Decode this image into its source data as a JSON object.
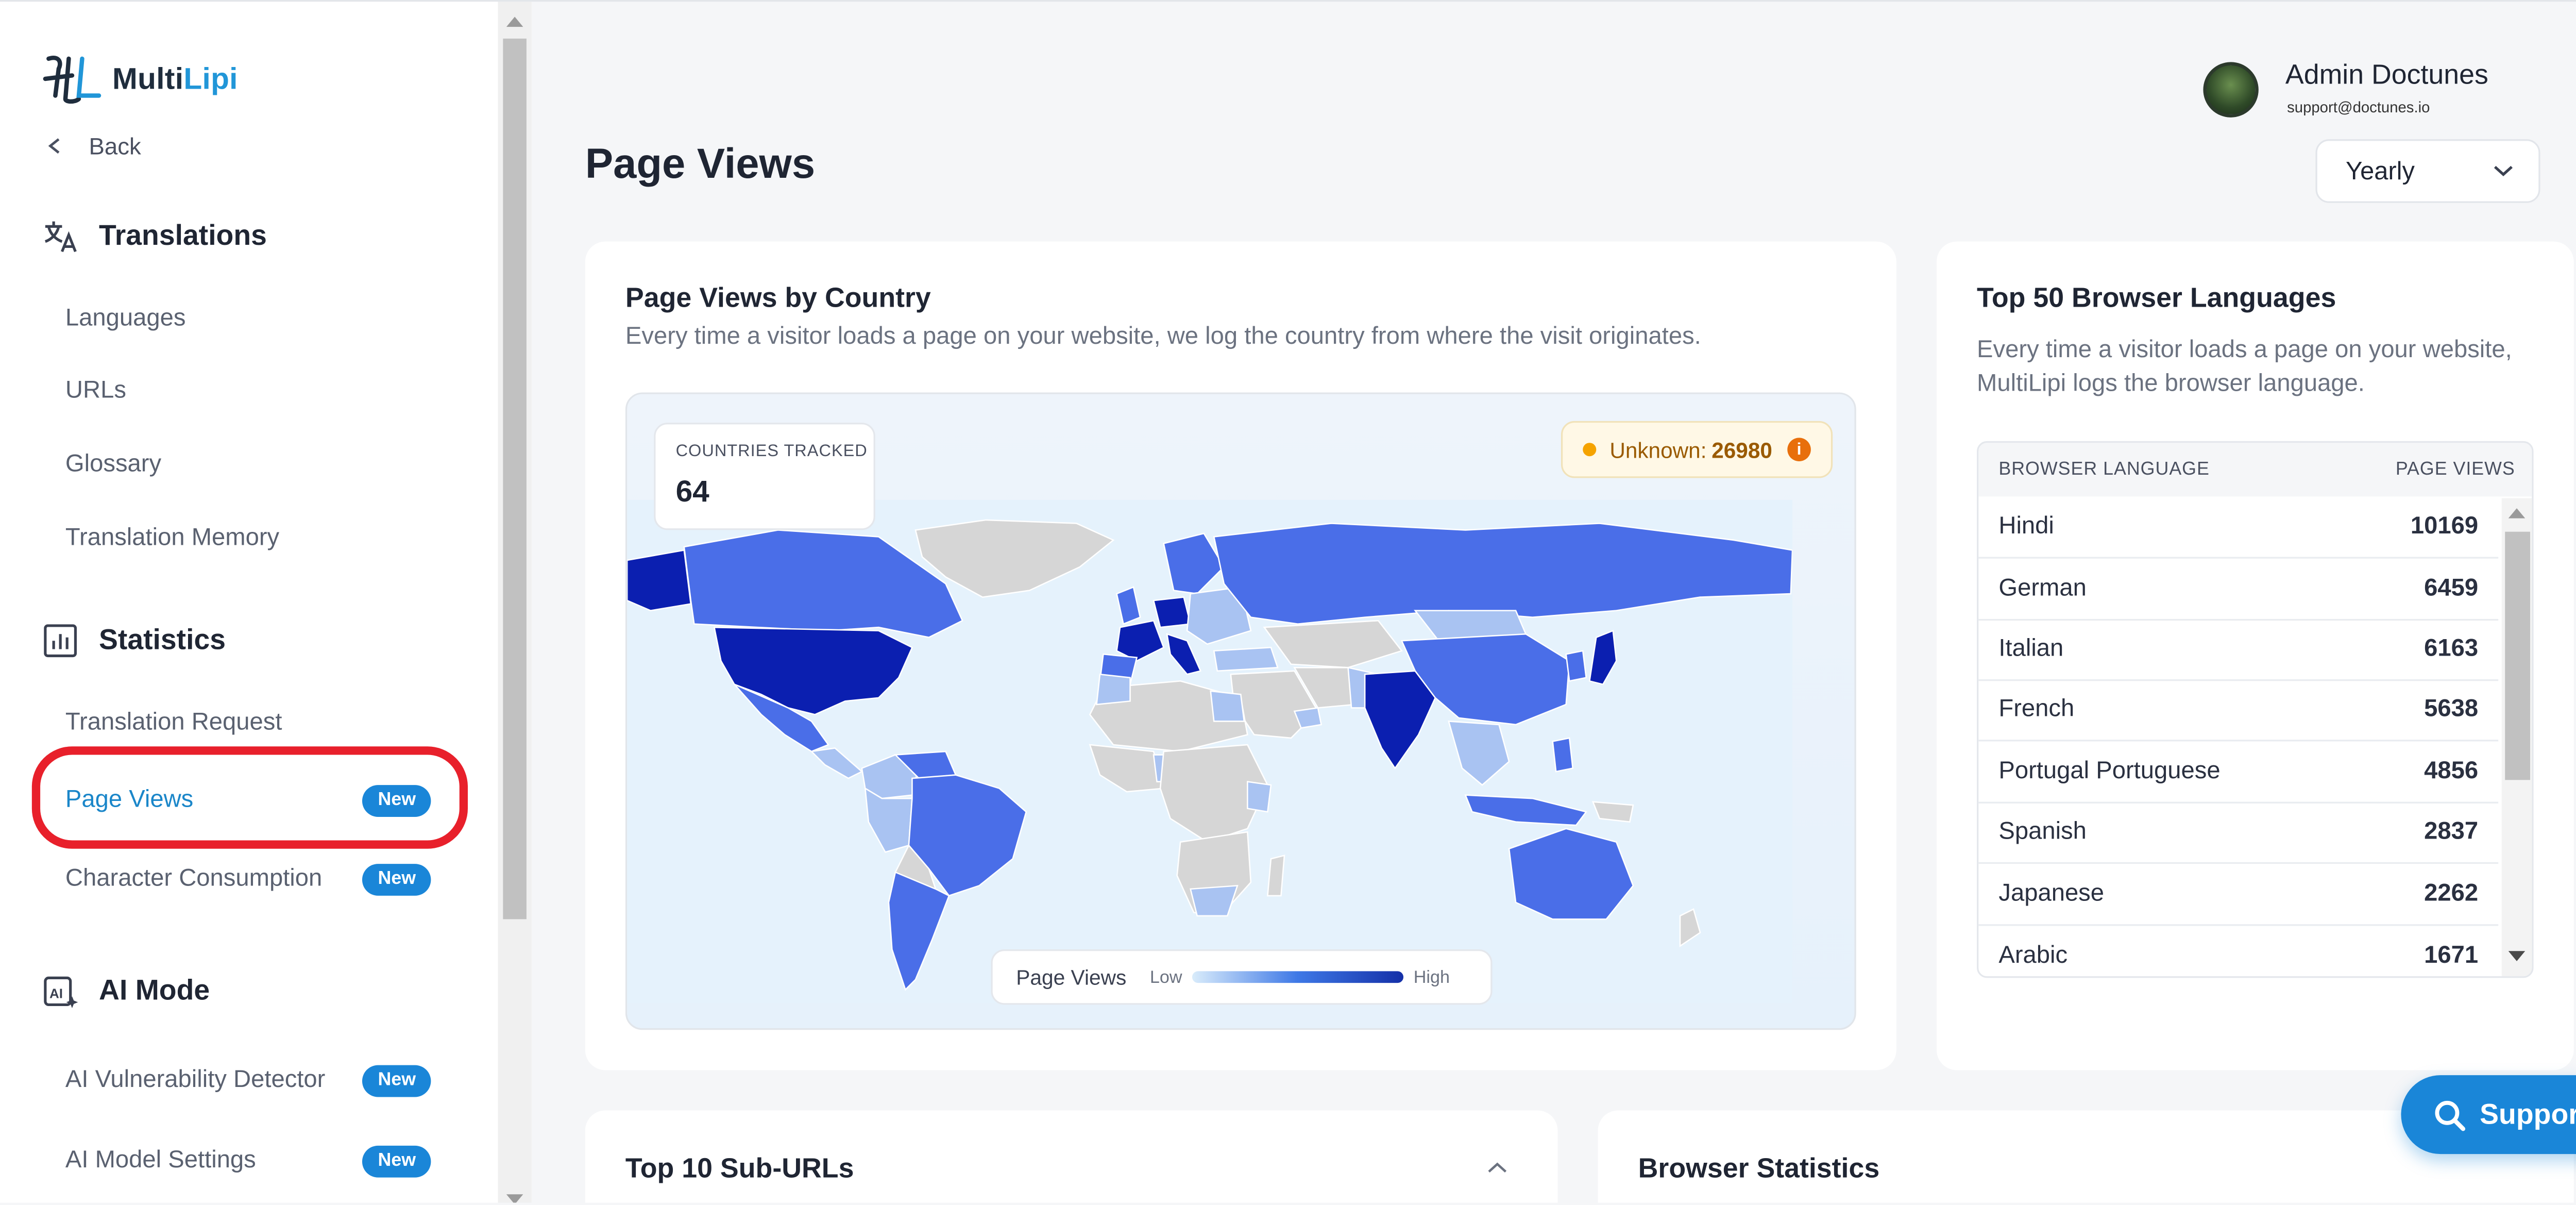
{
  "brand": {
    "name_prefix": "Multi",
    "name_suffix": "Lipi"
  },
  "nav": {
    "back_label": "Back",
    "translations": {
      "heading": "Translations",
      "items": [
        {
          "label": "Languages"
        },
        {
          "label": "URLs"
        },
        {
          "label": "Glossary"
        },
        {
          "label": "Translation Memory"
        }
      ]
    },
    "statistics": {
      "heading": "Statistics",
      "items": [
        {
          "label": "Translation Request",
          "badge": ""
        },
        {
          "label": "Page Views",
          "badge": "New",
          "active": true
        },
        {
          "label": "Character Consumption",
          "badge": "New"
        }
      ]
    },
    "ai_mode": {
      "heading": "AI Mode",
      "items": [
        {
          "label": "AI Vulnerability Detector",
          "badge": "New"
        },
        {
          "label": "AI Model Settings",
          "badge": "New"
        }
      ]
    }
  },
  "user": {
    "name": "Admin Doctunes",
    "email": "support@doctunes.io"
  },
  "page": {
    "title": "Page Views"
  },
  "period_select": {
    "value": "Yearly"
  },
  "country_card": {
    "title": "Page Views by Country",
    "description": "Every time a visitor loads a page on your website, we log the country from where the visit originates.",
    "countries_tracked_label": "COUNTRIES TRACKED",
    "countries_tracked_value": "64",
    "unknown_label": "Unknown:",
    "unknown_value": "26980",
    "legend": {
      "title": "Page Views",
      "low": "Low",
      "high": "High"
    },
    "colors": {
      "high": "#0b1fb0",
      "mid": "#4a6ee8",
      "low": "#a9c3f2",
      "none": "#d6d6d6",
      "ocean": "#e5f2fc"
    }
  },
  "languages_card": {
    "title": "Top 50 Browser Languages",
    "description": "Every time a visitor loads a page on your website, MultiLipi logs the browser language.",
    "columns": [
      "BROWSER LANGUAGE",
      "PAGE VIEWS"
    ],
    "rows": [
      {
        "language": "Hindi",
        "views": "10169"
      },
      {
        "language": "German",
        "views": "6459"
      },
      {
        "language": "Italian",
        "views": "6163"
      },
      {
        "language": "French",
        "views": "5638"
      },
      {
        "language": "Portugal Portuguese",
        "views": "4856"
      },
      {
        "language": "Spanish",
        "views": "2837"
      },
      {
        "language": "Japanese",
        "views": "2262"
      },
      {
        "language": "Arabic",
        "views": "1671"
      }
    ]
  },
  "sub_urls_card": {
    "title": "Top 10 Sub-URLs"
  },
  "browser_stats_card": {
    "title": "Browser Statistics"
  },
  "support_button": {
    "label": "Support"
  },
  "accent_color": "#1a86d8"
}
